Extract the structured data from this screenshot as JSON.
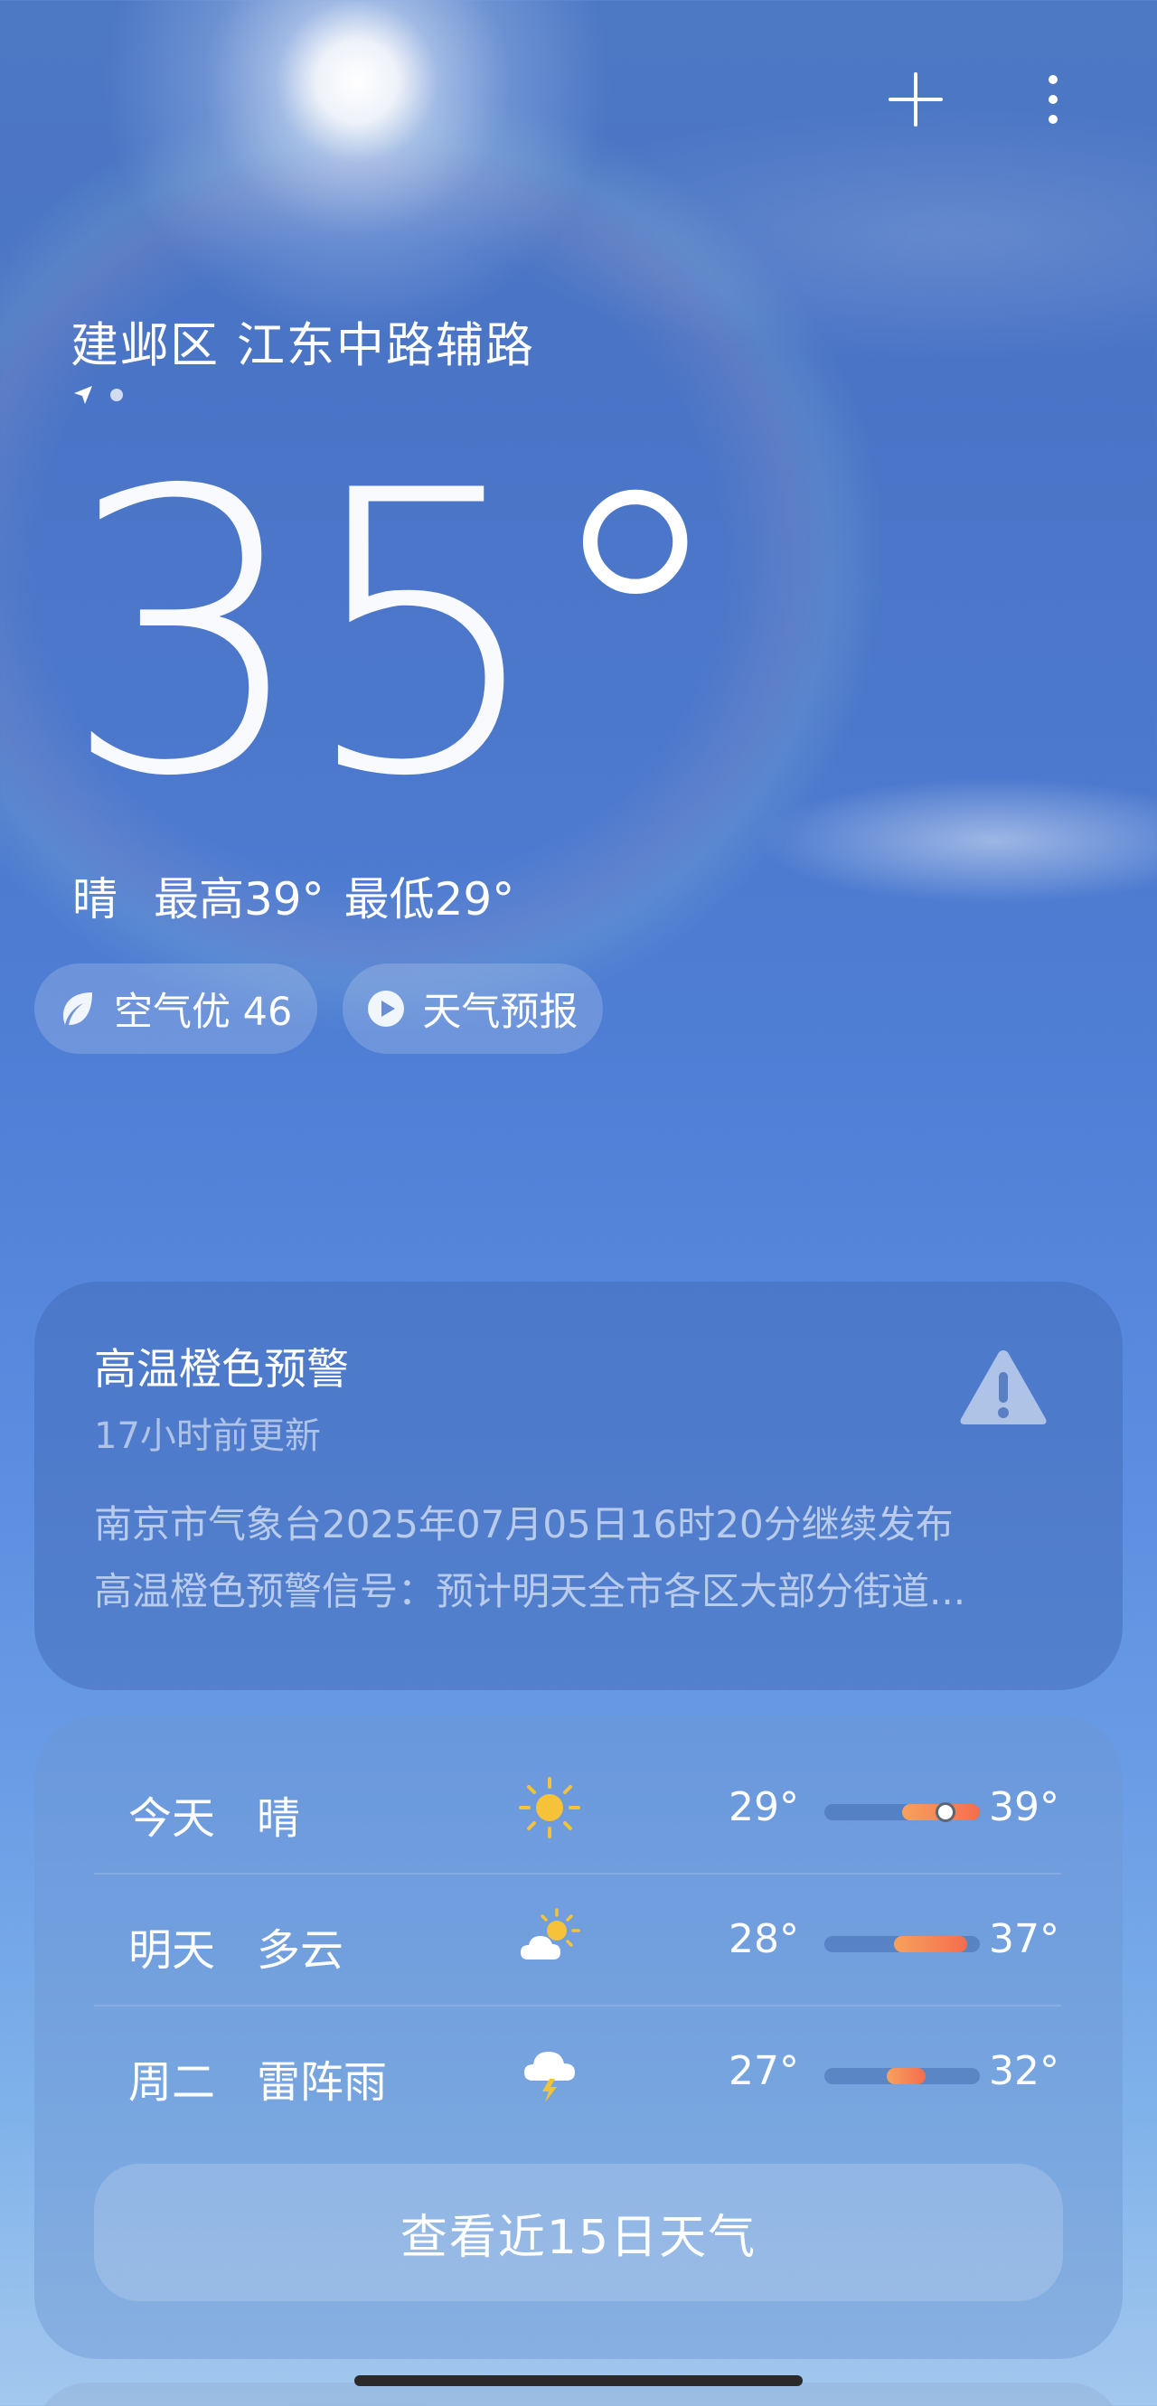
{
  "header": {
    "location": "建邺区 江东中路辅路"
  },
  "current": {
    "temperature": "35",
    "degree_symbol": "°",
    "condition": "晴",
    "high": "最高39°",
    "low": "最低29°"
  },
  "chips": {
    "air_quality": "空气优 46",
    "forecast_video": "天气预报"
  },
  "alert": {
    "title": "高温橙色预警",
    "updated": "17小时前更新",
    "body_line1": "南京市气象台2025年07月05日16时20分继续发布",
    "body_line2": "高温橙色预警信号：预计明天全市各区大部分街道..."
  },
  "forecast": {
    "days": [
      {
        "day": "今天",
        "condition": "晴",
        "icon": "sun-icon",
        "low": "29°",
        "high": "39°",
        "range_start": 0.5,
        "range_end": 1.0,
        "current_marker": 0.78
      },
      {
        "day": "明天",
        "condition": "多云",
        "icon": "partly-cloudy-icon",
        "low": "28°",
        "high": "37°",
        "range_start": 0.45,
        "range_end": 0.92
      },
      {
        "day": "周二",
        "condition": "雷阵雨",
        "icon": "thunderstorm-icon",
        "low": "27°",
        "high": "32°",
        "range_start": 0.4,
        "range_end": 0.65
      }
    ],
    "more_button": "查看近15日天气"
  },
  "colors": {
    "temp_bar_start": "#f7a15c",
    "temp_bar_end": "#f56d4e",
    "sun_icon": "#f6c23a"
  }
}
